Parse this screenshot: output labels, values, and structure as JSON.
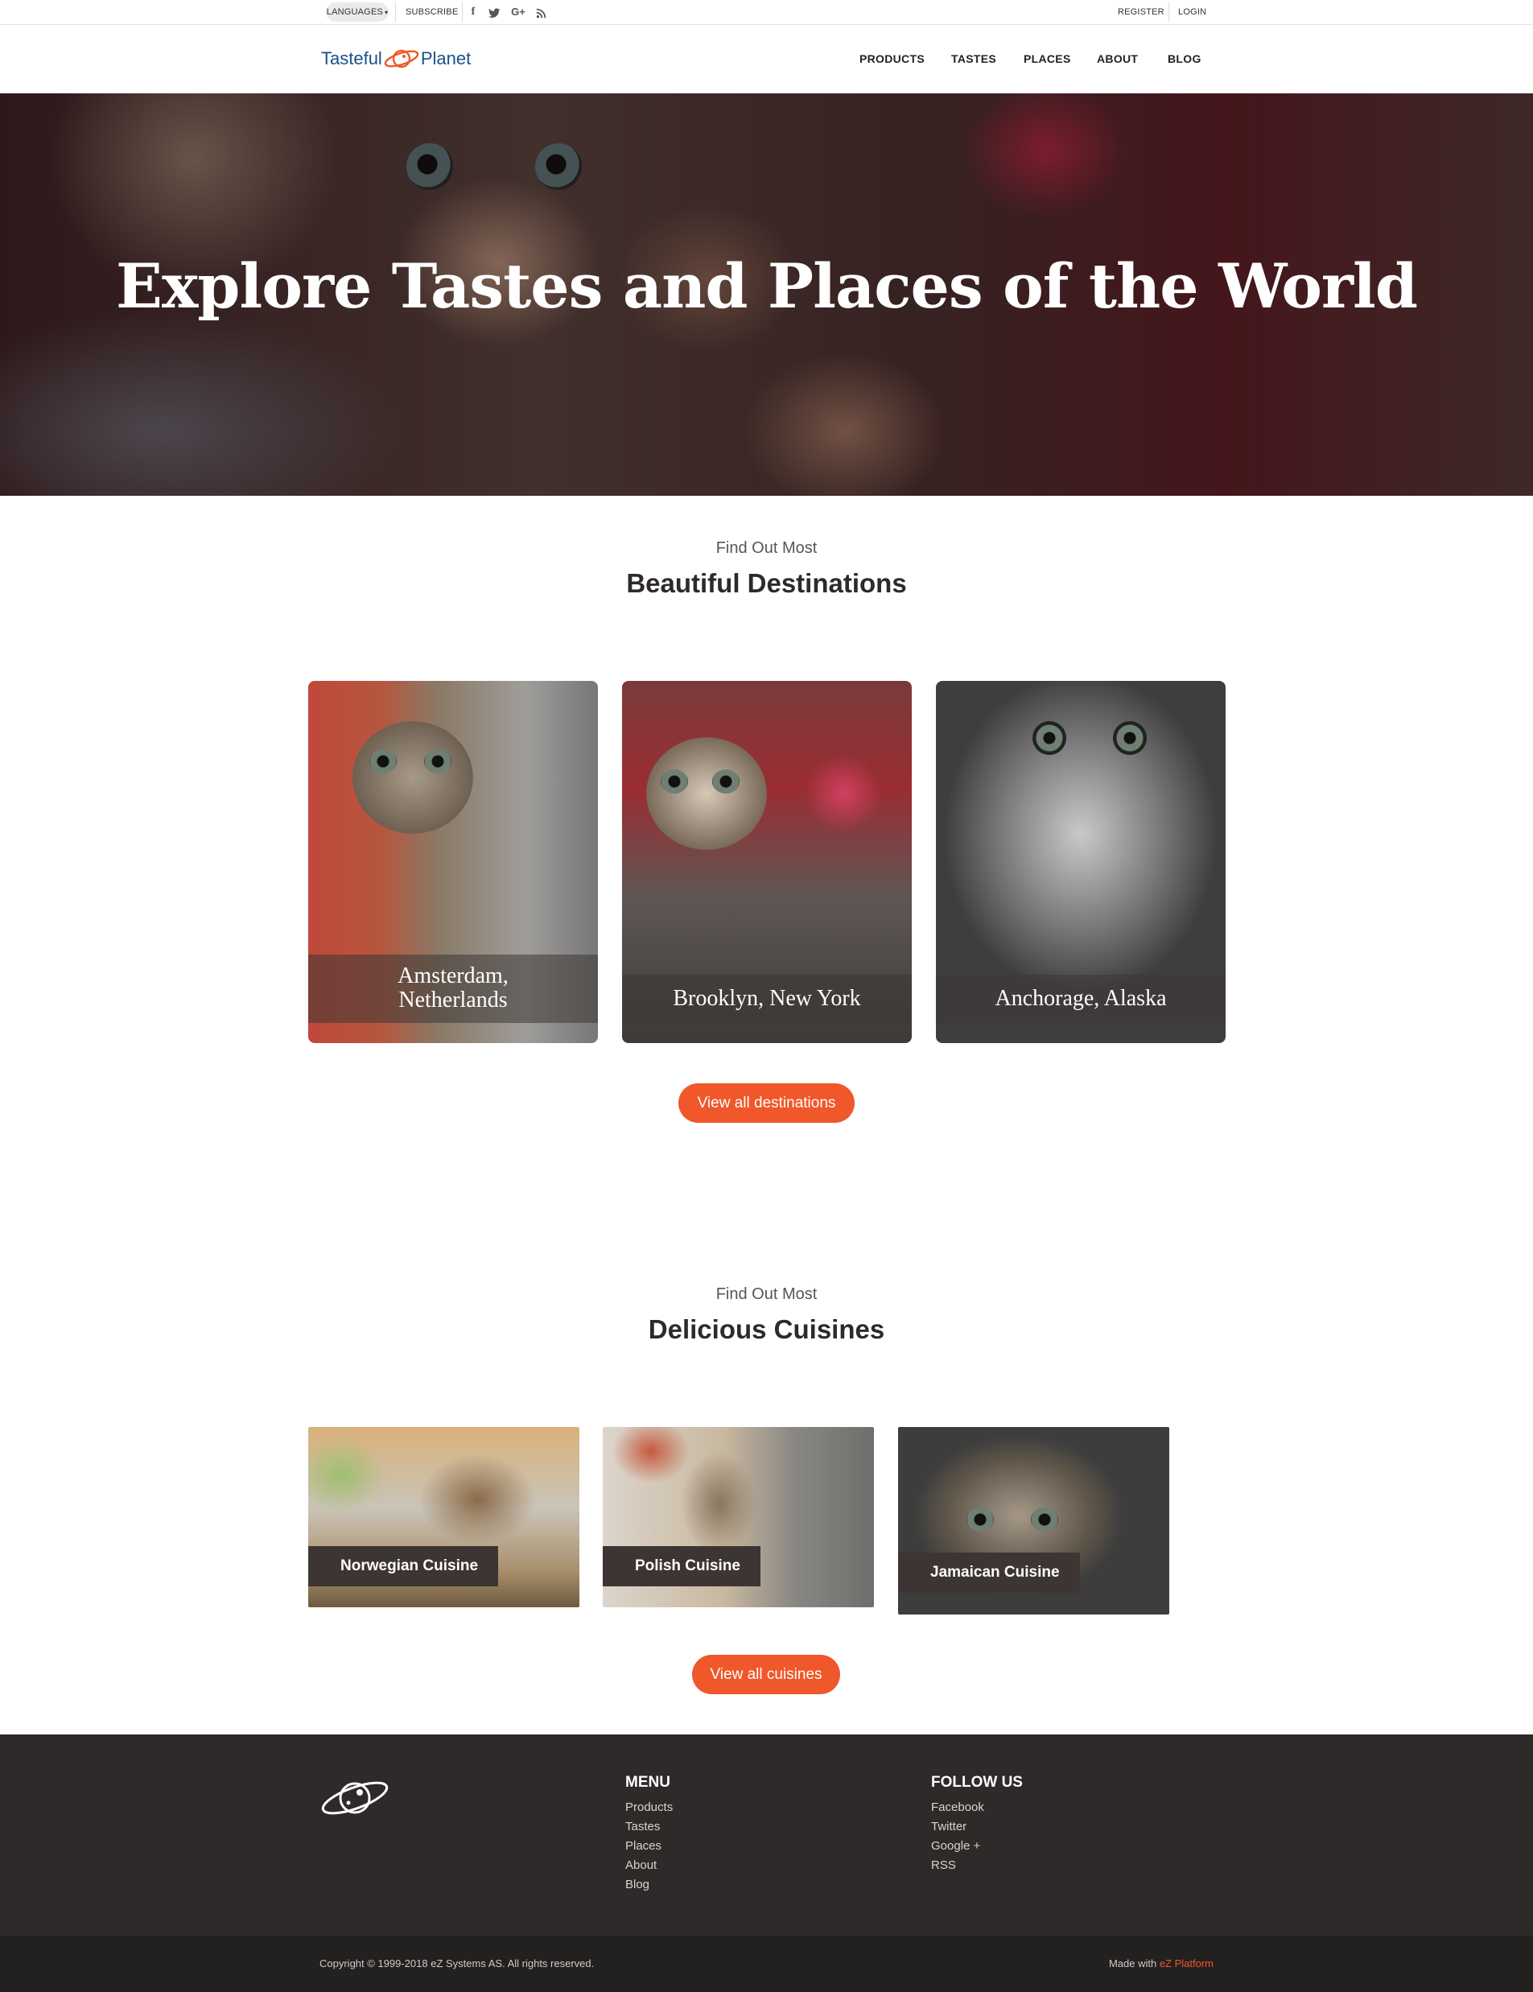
{
  "topbar": {
    "languages_label": "LANGUAGES",
    "subscribe_label": "SUBSCRIBE",
    "social": [
      {
        "icon": "facebook-icon",
        "glyph": "f"
      },
      {
        "icon": "twitter-icon",
        "glyph": "🐦"
      },
      {
        "icon": "google-plus-icon",
        "glyph": "G+"
      },
      {
        "icon": "rss-icon",
        "glyph": "◉"
      }
    ],
    "register_label": "REGISTER",
    "login_label": "LOGIN"
  },
  "header": {
    "logo_left": "Tasteful",
    "logo_right": "Planet",
    "nav": [
      "PRODUCTS",
      "TASTES",
      "PLACES",
      "ABOUT",
      "BLOG"
    ]
  },
  "hero": {
    "title": "Explore Tastes and Places of the World"
  },
  "destinations": {
    "kicker": "Find Out Most",
    "title": "Beautiful Destinations",
    "cards": [
      {
        "caption_line1": "Amsterdam,",
        "caption_line2": "Netherlands"
      },
      {
        "caption_line1": "Brooklyn, New York",
        "caption_line2": ""
      },
      {
        "caption_line1": "Anchorage, Alaska",
        "caption_line2": ""
      }
    ],
    "button": "View all destinations"
  },
  "cuisines": {
    "kicker": "Find Out Most",
    "title": "Delicious Cuisines",
    "cards": [
      {
        "label": "Norwegian Cuisine"
      },
      {
        "label": "Polish Cuisine"
      },
      {
        "label": "Jamaican Cuisine"
      }
    ],
    "button": "View all cuisines"
  },
  "footer": {
    "menu_heading": "MENU",
    "menu_links": [
      "Products",
      "Tastes",
      "Places",
      "About",
      "Blog"
    ],
    "follow_heading": "FOLLOW US",
    "follow_links": [
      "Facebook",
      "Twitter",
      "Google +",
      "RSS"
    ],
    "copyright": "Copyright © 1999-2018 eZ Systems AS. All rights reserved.",
    "made_with": "Made with",
    "made_brand": "eZ Platform"
  },
  "colors": {
    "accent": "#f0572a",
    "logo_blue": "#1b4f8a",
    "footer_bg": "#2e2a29",
    "bottom_bar_bg": "#232020"
  }
}
